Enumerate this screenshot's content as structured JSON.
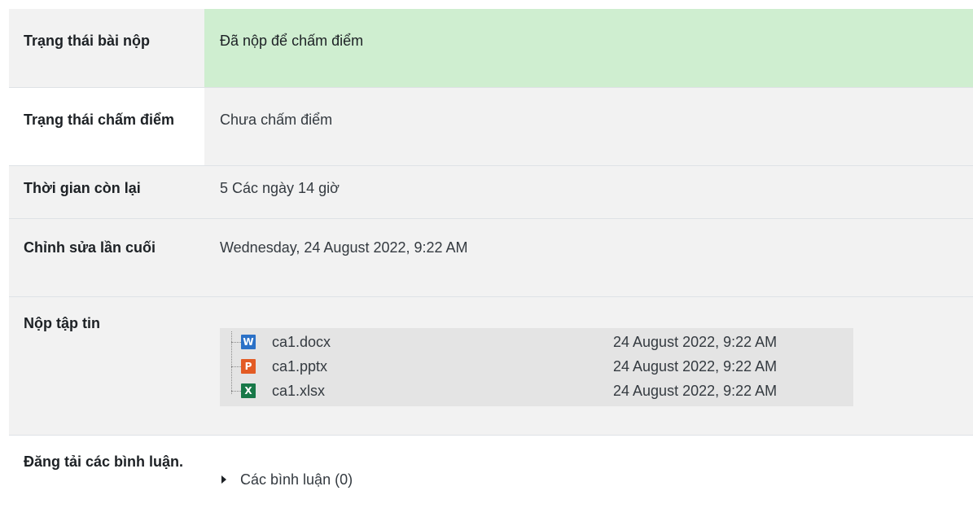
{
  "rows": {
    "submission_status": {
      "label": "Trạng thái bài nộp",
      "value": "Đã nộp để chấm điểm"
    },
    "grading_status": {
      "label": "Trạng thái chấm điểm",
      "value": "Chưa chấm điểm"
    },
    "time_remaining": {
      "label": "Thời gian còn lại",
      "value": "5 Các ngày 14 giờ"
    },
    "last_modified": {
      "label": "Chỉnh sửa lần cuối",
      "value": "Wednesday, 24 August 2022, 9:22 AM"
    },
    "file_submissions": {
      "label": "Nộp tập tin",
      "files": [
        {
          "name": "ca1.docx",
          "date": "24 August 2022, 9:22 AM",
          "icon": "word-icon",
          "icon_letter": "W"
        },
        {
          "name": "ca1.pptx",
          "date": "24 August 2022, 9:22 AM",
          "icon": "powerpoint-icon",
          "icon_letter": "P"
        },
        {
          "name": "ca1.xlsx",
          "date": "24 August 2022, 9:22 AM",
          "icon": "excel-icon",
          "icon_letter": "X"
        }
      ]
    },
    "submission_comments": {
      "label": "Đăng tải các bình luận.",
      "toggle_label": "Các bình luận (0)"
    }
  },
  "colors": {
    "status_submitted_bg": "#cfeed0",
    "header_bg": "#f2f2f2",
    "word": "#2b71c7",
    "powerpoint": "#e35b24",
    "excel": "#187848"
  }
}
